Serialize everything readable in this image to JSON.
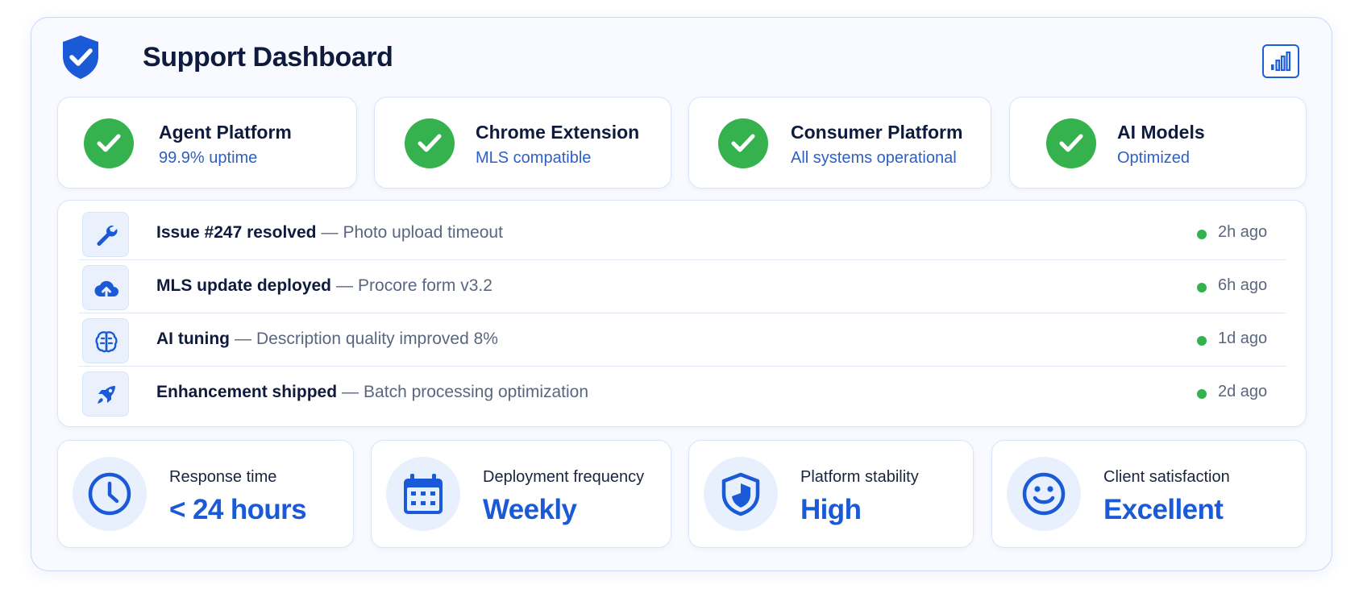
{
  "header": {
    "title": "Support Dashboard",
    "logo_icon": "shield-check-icon",
    "action_icon": "bar-chart-icon"
  },
  "status_cards": [
    {
      "name": "Agent Platform",
      "detail": "99.9% uptime",
      "icon": "check-circle-icon"
    },
    {
      "name": "Chrome Extension",
      "detail": "MLS compatible",
      "icon": "check-circle-icon"
    },
    {
      "name": "Consumer Platform",
      "detail": "All systems operational",
      "icon": "check-circle-icon"
    },
    {
      "name": "AI Models",
      "detail": "Optimized",
      "icon": "check-circle-icon"
    }
  ],
  "activity": [
    {
      "title": "Issue #247 resolved",
      "separator": "—",
      "detail": "Photo upload timeout",
      "time": "2h ago",
      "icon": "wrench-icon"
    },
    {
      "title": "MLS update deployed",
      "separator": "—",
      "detail": "Procore form v3.2",
      "time": "6h ago",
      "icon": "cloud-upload-icon"
    },
    {
      "title": "AI tuning",
      "separator": "—",
      "detail": "Description quality improved 8%",
      "time": "1d ago",
      "icon": "brain-icon"
    },
    {
      "title": "Enhancement shipped",
      "separator": "—",
      "detail": "Batch processing optimization",
      "time": "2d ago",
      "icon": "rocket-icon"
    }
  ],
  "metrics": [
    {
      "label": "Response time",
      "value": "< 24 hours",
      "icon": "clock-icon"
    },
    {
      "label": "Deployment frequency",
      "value": "Weekly",
      "icon": "calendar-icon"
    },
    {
      "label": "Platform stability",
      "value": "High",
      "icon": "shield-icon"
    },
    {
      "label": "Client satisfaction",
      "value": "Excellent",
      "icon": "smiley-icon"
    }
  ],
  "colors": {
    "accent": "#1b5ad6",
    "success": "#35b24d",
    "text_dark": "#0f1b3d",
    "text_muted": "#5a6680",
    "panel_border": "#c9d8f7"
  }
}
